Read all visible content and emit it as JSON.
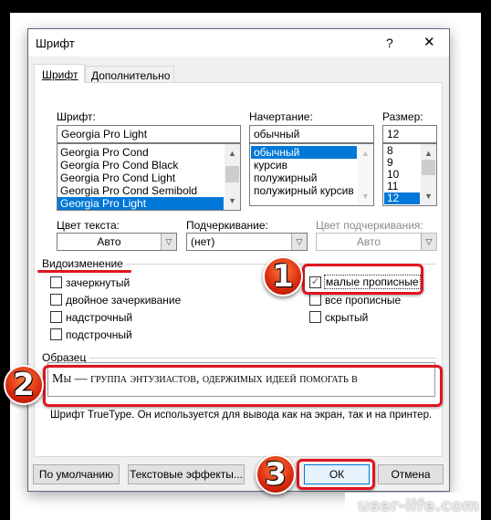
{
  "dialog": {
    "title": "Шрифт",
    "help": "?",
    "close": "✕"
  },
  "tabs": [
    {
      "label": "Шрифт",
      "active": true
    },
    {
      "label": "Дополнительно",
      "active": false
    }
  ],
  "font": {
    "label": "Шрифт:",
    "value": "Georgia Pro Light",
    "items": [
      "Georgia Pro Cond",
      "Georgia Pro Cond Black",
      "Georgia Pro Cond Light",
      "Georgia Pro Cond Semibold",
      "Georgia Pro Light"
    ],
    "selected": "Georgia Pro Light"
  },
  "style": {
    "label": "Начертание:",
    "value": "обычный",
    "items": [
      "обычный",
      "курсив",
      "полужирный",
      "полужирный курсив"
    ],
    "selected": "обычный"
  },
  "size": {
    "label": "Размер:",
    "value": "12",
    "items": [
      "8",
      "9",
      "10",
      "11",
      "12"
    ],
    "selected": "12"
  },
  "text_color": {
    "label": "Цвет текста:",
    "value": "Авто"
  },
  "underline": {
    "label": "Подчеркивание:",
    "value": "(нет)"
  },
  "underline_color": {
    "label": "Цвет подчеркивания:",
    "value": "Авто",
    "disabled": true
  },
  "effects": {
    "label": "Видоизменение",
    "left": [
      {
        "label": "зачеркнутый",
        "checked": false
      },
      {
        "label": "двойное зачеркивание",
        "checked": false
      },
      {
        "label": "надстрочный",
        "checked": false
      },
      {
        "label": "подстрочный",
        "checked": false
      }
    ],
    "right": [
      {
        "label": "малые прописные",
        "checked": true
      },
      {
        "label": "все прописные",
        "checked": false
      },
      {
        "label": "скрытый",
        "checked": false
      }
    ]
  },
  "preview": {
    "label": "Образец",
    "text": "Мы — группа энтузиастов, одержимых идеей помогать в",
    "note": "Шрифт TrueType. Он используется для вывода как на экран, так и на принтер."
  },
  "buttons": {
    "default": "По умолчанию",
    "effects": "Текстовые эффекты...",
    "ok": "ОК",
    "cancel": "Отмена"
  },
  "annotations": [
    "1",
    "2",
    "3"
  ],
  "watermark": "user-life.com",
  "colors": {
    "accent": "#0078d7",
    "annotation_red": "#e0141e"
  }
}
